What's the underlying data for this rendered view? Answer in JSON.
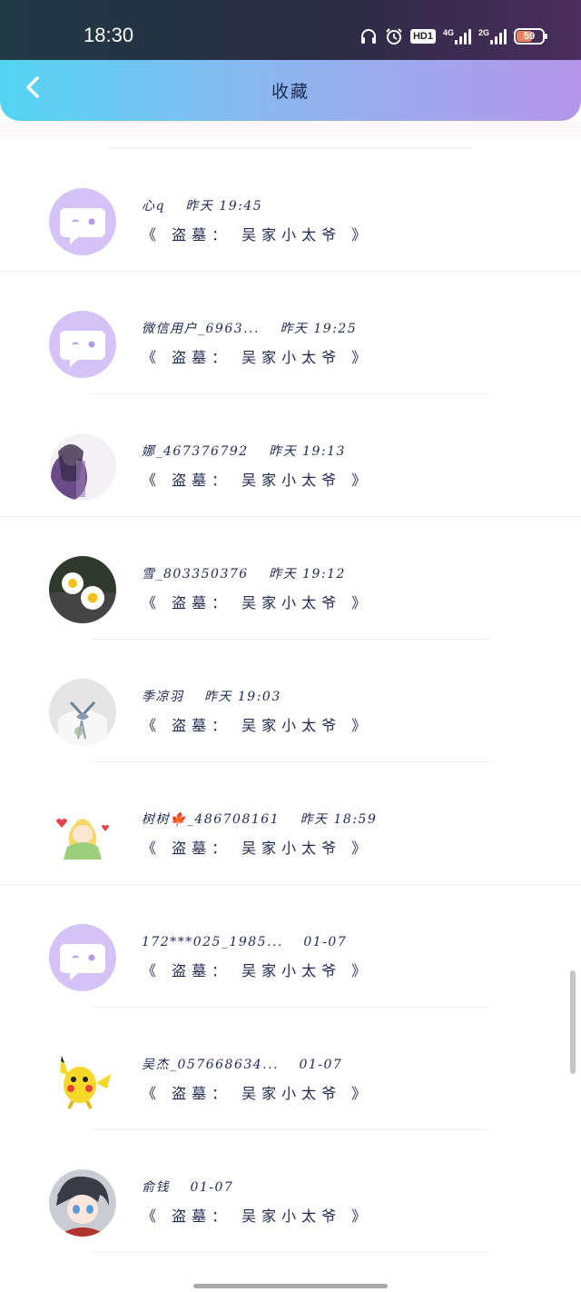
{
  "status_bar": {
    "time": "18:30",
    "hd_label": "HD1",
    "net1_label": "4G",
    "net2_label": "2G",
    "battery_level": "59",
    "icons": [
      "headphones-icon",
      "alarm-icon",
      "hd-icon",
      "signal-4g-icon",
      "signal-2g-icon",
      "battery-icon"
    ]
  },
  "header": {
    "title": "收藏",
    "back_icon": "chevron-left-icon"
  },
  "items": [
    {
      "name": "心q",
      "time": "昨天 19:45",
      "title": "《 盗墓： 吴家小太爷 》",
      "avatar": "default-chat-avatar"
    },
    {
      "name": "微信用户_6963...",
      "time": "昨天 19:25",
      "title": "《 盗墓： 吴家小太爷 》",
      "avatar": "default-chat-avatar"
    },
    {
      "name": "娜_467376792",
      "time": "昨天 19:13",
      "title": "《 盗墓： 吴家小太爷 》",
      "avatar": "girl-photo-avatar"
    },
    {
      "name": "雪_803350376",
      "time": "昨天 19:12",
      "title": "《 盗墓： 吴家小太爷 》",
      "avatar": "daisy-photo-avatar"
    },
    {
      "name": "季凉羽",
      "time": "昨天 19:03",
      "title": "《 盗墓： 吴家小太爷 》",
      "avatar": "uniform-photo-avatar"
    },
    {
      "name": "树树🍁_486708161",
      "time": "昨天 18:59",
      "title": "《 盗墓： 吴家小太爷 》",
      "avatar": "cartoon-girl-avatar"
    },
    {
      "name": "172***025_1985...",
      "time": "01-07",
      "title": "《 盗墓： 吴家小太爷 》",
      "avatar": "default-chat-avatar"
    },
    {
      "name": "吴杰_057668634...",
      "time": "01-07",
      "title": "《 盗墓： 吴家小太爷 》",
      "avatar": "pikachu-avatar"
    },
    {
      "name": "俞钱",
      "time": "01-07",
      "title": "《 盗墓： 吴家小太爷 》",
      "avatar": "anime-boy-avatar"
    }
  ],
  "colors": {
    "header_gradient_start": "#53d5f3",
    "header_gradient_end": "#b596ea",
    "text_primary": "#1e2a52",
    "default_avatar": "#d5c3f7"
  }
}
